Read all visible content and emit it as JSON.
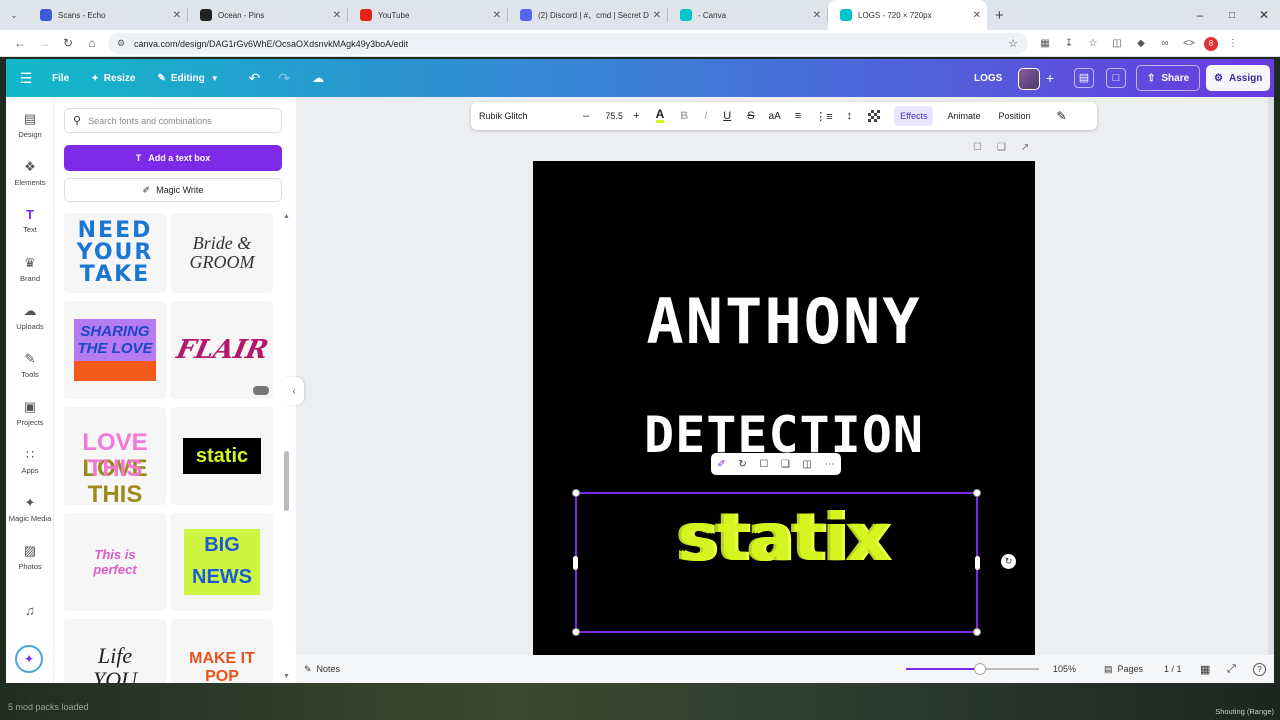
{
  "browser": {
    "tabs": [
      {
        "label": "Scans - Echo",
        "icon": "echo-icon",
        "color": "#3b5bdb"
      },
      {
        "label": "Ocean - Pins",
        "icon": "pins-icon",
        "color": "#222222"
      },
      {
        "label": "YouTube",
        "icon": "youtube-icon",
        "color": "#e62117"
      },
      {
        "label": "(2) Discord | #、cmd | Secret D",
        "icon": "discord-icon",
        "color": "#5865f2"
      },
      {
        "label": "- Canva",
        "icon": "canva-icon",
        "color": "#00c4cc"
      },
      {
        "label": "LOGS - 720 × 720px",
        "icon": "canva-icon",
        "color": "#00c4cc"
      }
    ],
    "url": "canva.com/design/DAG1rGv6WhE/OcsaOXdsnvkMAgk49y3boA/edit",
    "profile_initial": "8"
  },
  "header": {
    "file": "File",
    "resize": "Resize",
    "editing": "Editing",
    "design_title": "LOGS",
    "share": "Share",
    "assign": "Assign"
  },
  "sidebar": [
    {
      "label": "Design",
      "icon": "design-icon",
      "glyph": "▤"
    },
    {
      "label": "Elements",
      "icon": "elements-icon",
      "glyph": "❖"
    },
    {
      "label": "Text",
      "icon": "text-icon",
      "glyph": "T"
    },
    {
      "label": "Brand",
      "icon": "brand-icon",
      "glyph": "♛"
    },
    {
      "label": "Uploads",
      "icon": "uploads-icon",
      "glyph": "☁"
    },
    {
      "label": "Tools",
      "icon": "tools-icon",
      "glyph": "✎"
    },
    {
      "label": "Projects",
      "icon": "projects-icon",
      "glyph": "▣"
    },
    {
      "label": "Apps",
      "icon": "apps-icon",
      "glyph": "∷"
    },
    {
      "label": "Magic Media",
      "icon": "magic-media-icon",
      "glyph": "✦"
    },
    {
      "label": "Photos",
      "icon": "photos-icon",
      "glyph": "▨"
    }
  ],
  "panel": {
    "search_placeholder": "Search fonts and combinations",
    "add_text_box": "Add a text box",
    "magic_write": "Magic Write",
    "templates": [
      {
        "text": "NEED YOUR TAKE"
      },
      {
        "text": "Bride & GROOM"
      },
      {
        "text": "SHARING THE LOVE"
      },
      {
        "text": "FLAIR"
      },
      {
        "text": "LOVE THIS"
      },
      {
        "text": "static"
      },
      {
        "text": "This is perfect"
      },
      {
        "text": "BIG NEWS"
      },
      {
        "text": "Life YOU"
      },
      {
        "text": "MAKE IT POP"
      }
    ]
  },
  "toolbar": {
    "font": "Rubik Glitch",
    "size": "75.5",
    "effects": "Effects",
    "animate": "Animate",
    "position": "Position"
  },
  "canvas": {
    "line1": "ANTHONY",
    "line2": "DETECTION",
    "line3": "statix",
    "accent": "#d4f51f"
  },
  "footer": {
    "notes": "Notes",
    "zoom": "105%",
    "pages": "Pages",
    "page_count": "1 / 1",
    "zoom_level": 0.56
  },
  "taskbar": {
    "left_text": "5 mod packs loaded",
    "right_text": "Shouting (Range)"
  }
}
